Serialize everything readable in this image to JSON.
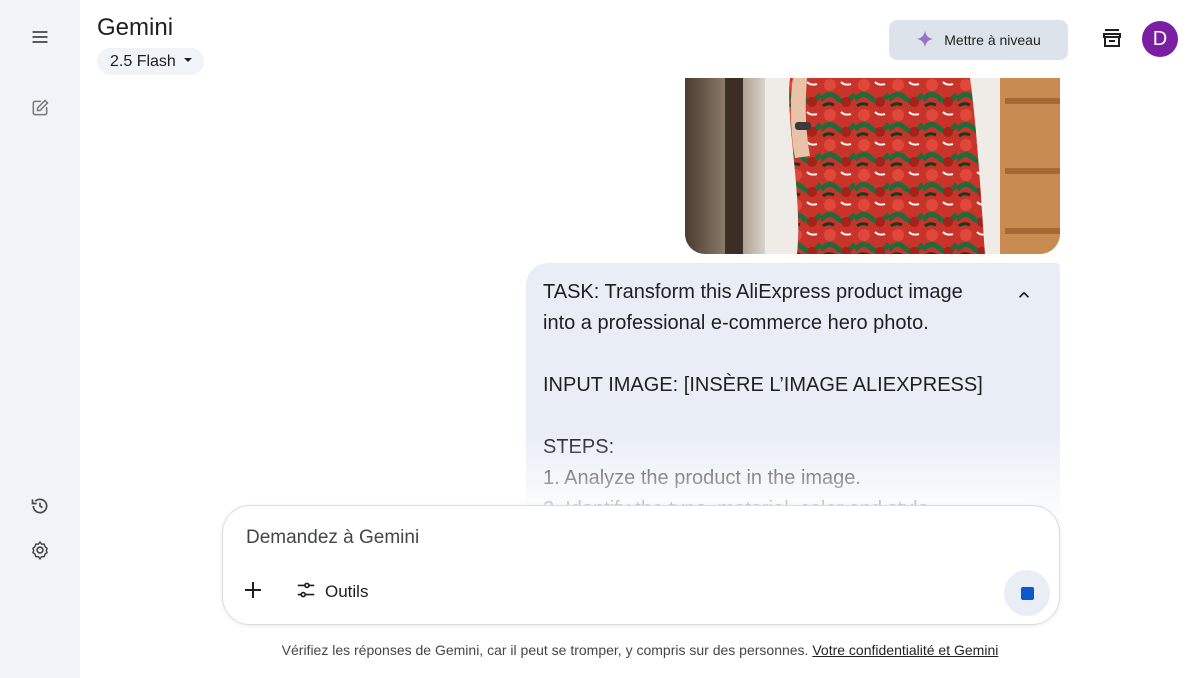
{
  "app": {
    "brand": "Gemini",
    "model_label": "2.5 Flash",
    "upgrade_label": "Mettre à niveau"
  },
  "user": {
    "avatar_initial": "D",
    "avatar_color": "#7b1fa2"
  },
  "sidebar": {
    "items": [
      {
        "name": "menu-icon"
      },
      {
        "name": "new-chat-icon"
      },
      {
        "name": "activity-icon"
      },
      {
        "name": "settings-icon"
      }
    ]
  },
  "conversation": {
    "prompt_text": "TASK: Transform this AliExpress product image into a professional e-commerce hero photo.\n\nINPUT IMAGE: [INSÈRE L’IMAGE ALIEXPRESS]\n\nSTEPS:\n1. Analyze the product in the image.\n2. Identify the type, material, color and style."
  },
  "composer": {
    "placeholder": "Demandez à Gemini",
    "tools_label": "Outils"
  },
  "footer": {
    "disclaimer": "Vérifiez les réponses de Gemini, car il peut se tromper, y compris sur des personnes.",
    "privacy_link": "Votre confidentialité et Gemini"
  },
  "colors": {
    "accent": "#0b57d0",
    "rail_bg": "#f0f4f9",
    "bubble_bg": "#e9eef6",
    "upgrade_bg": "#dde3ea"
  }
}
